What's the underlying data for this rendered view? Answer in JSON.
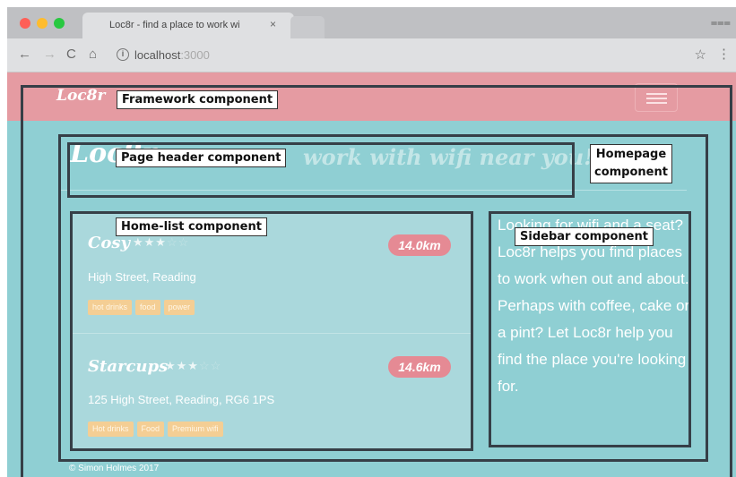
{
  "browser": {
    "tab_title": "Loc8r - find a place to work wi",
    "tab_close_glyph": "×",
    "url_host": "localhost",
    "url_port": ":3000",
    "icons": [
      "back-arrow-icon",
      "forward-arrow-icon",
      "reload-icon",
      "home-icon",
      "info-icon",
      "star-icon",
      "kebab-menu-icon"
    ]
  },
  "navbar": {
    "brand": "Loc8r"
  },
  "page_header": {
    "title": "Loc8r",
    "tagline": "work with wifi near you!"
  },
  "locations": [
    {
      "name": "Cosy",
      "rating": 3,
      "distance": "14.0km",
      "address": "High Street, Reading",
      "facilities": [
        "hot drinks",
        "food",
        "power"
      ]
    },
    {
      "name": "Starcups",
      "rating": 3,
      "distance": "14.6km",
      "address": "125 High Street, Reading, RG6 1PS",
      "facilities": [
        "Hot drinks",
        "Food",
        "Premium wifi"
      ]
    }
  ],
  "sidebar": {
    "text": "Looking for wifi and a seat? Loc8r helps you find places to work when out and about. Perhaps with coffee, cake or a pint? Let Loc8r help you find the place you're looking for."
  },
  "footer": {
    "text": "© Simon Holmes 2017"
  },
  "annotations": {
    "framework": "Framework component",
    "homepage": "Homepage component",
    "page_header": "Page header component",
    "home_list": "Home-list component",
    "sidebar": "Sidebar component"
  },
  "colors": {
    "navbar": "#e59ba2",
    "page_background": "#8fcfd3",
    "distance_badge": "#e58a94",
    "facility_tag": "#f4ce94",
    "annotation_outline": "#363f47"
  }
}
